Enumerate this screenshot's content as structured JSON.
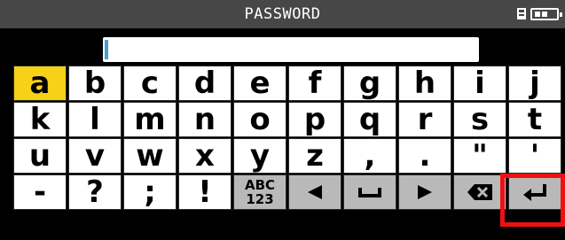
{
  "header": {
    "title": "PASSWORD"
  },
  "icons": {
    "storage": "sd-card-icon",
    "battery": "battery-icon"
  },
  "input": {
    "value": ""
  },
  "keyboard": {
    "rows": [
      [
        "a",
        "b",
        "c",
        "d",
        "e",
        "f",
        "g",
        "h",
        "i",
        "j"
      ],
      [
        "k",
        "l",
        "m",
        "n",
        "o",
        "p",
        "q",
        "r",
        "s",
        "t"
      ],
      [
        "u",
        "v",
        "w",
        "x",
        "y",
        "z",
        ",",
        ".",
        "\"",
        "'"
      ],
      [
        "-",
        "?",
        ";",
        "!"
      ]
    ],
    "mode_key": {
      "line1": "ABC",
      "line2": "123"
    },
    "selected_key": "a",
    "function_keys": [
      "cursor-left-icon",
      "space-icon",
      "cursor-right-icon",
      "backspace-icon",
      "enter-icon"
    ]
  },
  "colors": {
    "selected_key": "#f7d117",
    "highlight_box": "#ee1111",
    "titlebar": "#474747",
    "function_key": "#b9b9b9"
  }
}
